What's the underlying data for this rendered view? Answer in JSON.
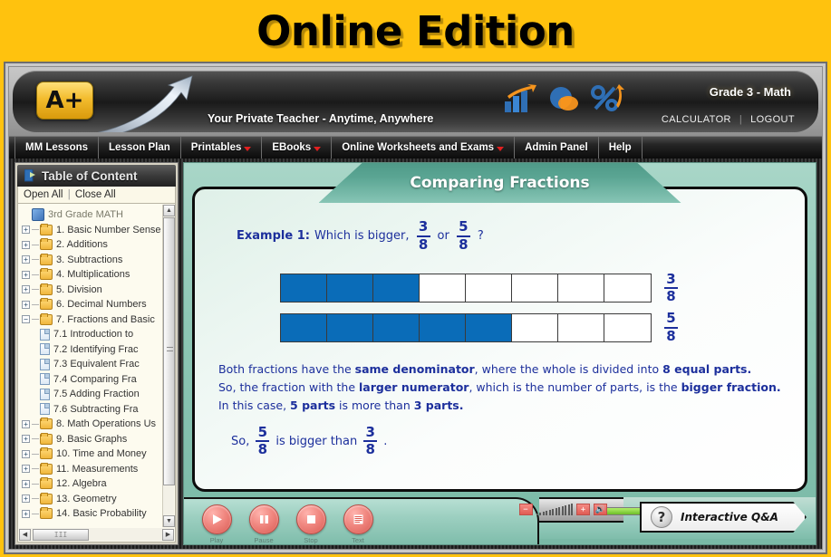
{
  "banner": {
    "title": "Online Edition"
  },
  "header": {
    "logo_text": "A+",
    "tagline": "Your Private Teacher - Anytime, Anywhere",
    "grade_label": "Grade 3 - Math",
    "calculator_label": "CALCULATOR",
    "logout_label": "LOGOUT",
    "separator": "|",
    "icons": [
      "bar-chart-icon",
      "pie-chart-icon",
      "percent-icon"
    ]
  },
  "menu": {
    "items": [
      {
        "label": "MM Lessons",
        "caret": false
      },
      {
        "label": "Lesson Plan",
        "caret": false
      },
      {
        "label": "Printables",
        "caret": true
      },
      {
        "label": "EBooks",
        "caret": true
      },
      {
        "label": "Online Worksheets and Exams",
        "caret": true
      },
      {
        "label": "Admin Panel",
        "caret": false
      },
      {
        "label": "Help",
        "caret": false
      }
    ]
  },
  "sidebar": {
    "header_title": "Table of Content",
    "open_all": "Open All",
    "close_all": "Close All",
    "separator": "|",
    "tree": [
      {
        "label": "3rd Grade MATH",
        "type": "root",
        "expander": ""
      },
      {
        "label": "1. Basic Number Sense",
        "type": "folder",
        "expander": "+"
      },
      {
        "label": "2. Additions",
        "type": "folder",
        "expander": "+"
      },
      {
        "label": "3. Subtractions",
        "type": "folder",
        "expander": "+"
      },
      {
        "label": "4. Multiplications",
        "type": "folder",
        "expander": "+"
      },
      {
        "label": "5. Division",
        "type": "folder",
        "expander": "+"
      },
      {
        "label": "6. Decimal Numbers",
        "type": "folder",
        "expander": "+"
      },
      {
        "label": "7. Fractions and Basic",
        "type": "folder",
        "expander": "−"
      },
      {
        "label": "7.1 Introduction to",
        "type": "page",
        "expander": ""
      },
      {
        "label": "7.2 Identifying Frac",
        "type": "page",
        "expander": ""
      },
      {
        "label": "7.3 Equivalent Frac",
        "type": "page",
        "expander": ""
      },
      {
        "label": "7.4 Comparing Fra",
        "type": "page",
        "expander": ""
      },
      {
        "label": "7.5 Adding Fraction",
        "type": "page",
        "expander": ""
      },
      {
        "label": "7.6 Subtracting Fra",
        "type": "page",
        "expander": ""
      },
      {
        "label": "8. Math Operations Us",
        "type": "folder",
        "expander": "+"
      },
      {
        "label": "9. Basic Graphs",
        "type": "folder",
        "expander": "+"
      },
      {
        "label": "10. Time and Money",
        "type": "folder",
        "expander": "+"
      },
      {
        "label": "11. Measurements",
        "type": "folder",
        "expander": "+"
      },
      {
        "label": "12. Algebra",
        "type": "folder",
        "expander": "+"
      },
      {
        "label": "13. Geometry",
        "type": "folder",
        "expander": "+"
      },
      {
        "label": "14. Basic Probability",
        "type": "folder",
        "expander": "+"
      }
    ]
  },
  "lesson": {
    "title": "Comparing Fractions",
    "example": {
      "label": "Example 1:",
      "question_start": "Which is bigger,",
      "fraction_a": {
        "num": "3",
        "den": "8"
      },
      "connector": "or",
      "fraction_b": {
        "num": "5",
        "den": "8"
      },
      "question_end": "?"
    },
    "bars": [
      {
        "total": 8,
        "filled": 3,
        "label": {
          "num": "3",
          "den": "8"
        }
      },
      {
        "total": 8,
        "filled": 5,
        "label": {
          "num": "5",
          "den": "8"
        }
      }
    ],
    "explanation": [
      [
        {
          "t": "Both fractions have the ",
          "b": false
        },
        {
          "t": "same denominator",
          "b": true
        },
        {
          "t": ", where the whole is divided into ",
          "b": false
        },
        {
          "t": "8 equal parts.",
          "b": true
        }
      ],
      [
        {
          "t": "So, the fraction with the ",
          "b": false
        },
        {
          "t": "larger numerator",
          "b": true
        },
        {
          "t": ", which is the number of parts, is the ",
          "b": false
        },
        {
          "t": "bigger fraction.",
          "b": true
        }
      ],
      [
        {
          "t": "In this case, ",
          "b": false
        },
        {
          "t": "5 parts",
          "b": true
        },
        {
          "t": " is more than ",
          "b": false
        },
        {
          "t": "3 parts.",
          "b": true
        }
      ]
    ],
    "conclusion": {
      "prefix": "So,",
      "fraction_a": {
        "num": "5",
        "den": "8"
      },
      "middle": "is bigger than",
      "fraction_b": {
        "num": "3",
        "den": "8"
      },
      "suffix": "."
    }
  },
  "controls": {
    "media": [
      {
        "label": "Play",
        "icon": "play-icon"
      },
      {
        "label": "Pause",
        "icon": "pause-icon"
      },
      {
        "label": "Stop",
        "icon": "stop-icon"
      },
      {
        "label": "Text",
        "icon": "text-icon"
      }
    ],
    "volume_down": "−",
    "volume_up": "+",
    "speaker_icon": "speaker-icon",
    "qa_label": "Interactive Q&A",
    "qa_mark": "?",
    "collapse_icon": "chevron-down-icon"
  },
  "colors": {
    "banner_yellow": "#ffc20e",
    "fill_blue": "#0a6cb8",
    "math_navy": "#1c2f9c",
    "panel_teal": "#8ec7b5",
    "media_red": "#e05c53"
  }
}
